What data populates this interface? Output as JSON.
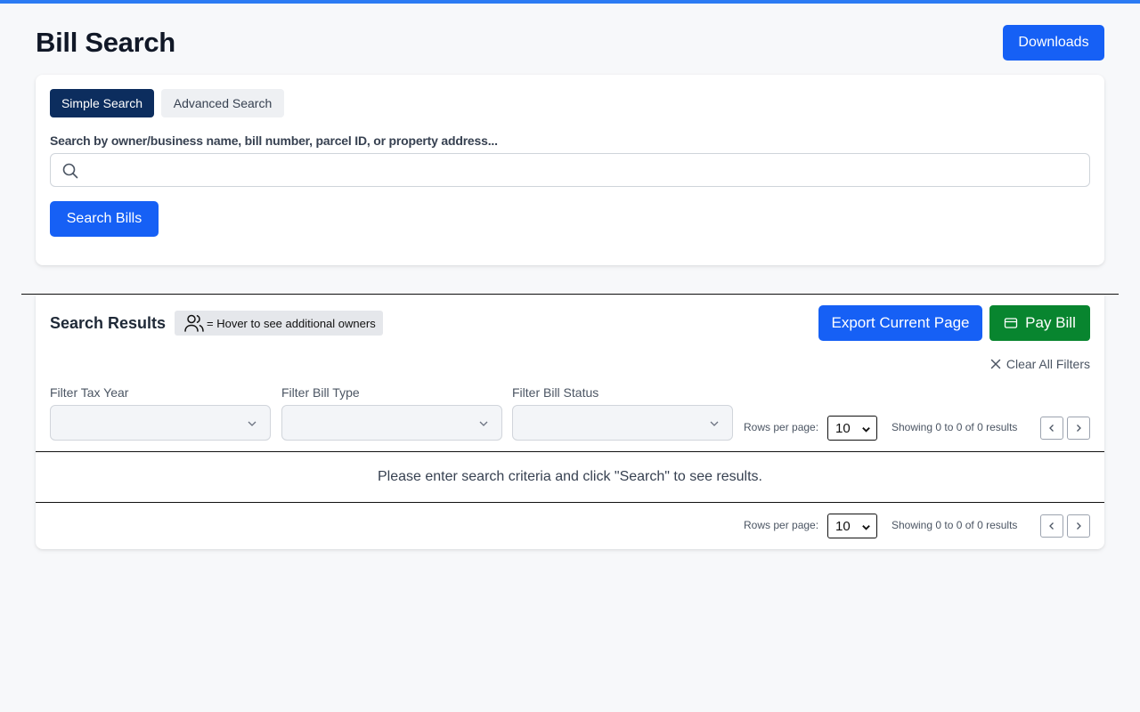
{
  "header": {
    "title": "Bill Search",
    "downloads_label": "Downloads"
  },
  "search": {
    "tabs": [
      {
        "label": "Simple Search",
        "active": true
      },
      {
        "label": "Advanced Search",
        "active": false
      }
    ],
    "label": "Search by owner/business name, bill number, parcel ID, or property address...",
    "value": "",
    "placeholder": "",
    "submit_label": "Search Bills"
  },
  "results": {
    "title": "Search Results",
    "owners_hint": "= Hover to see additional owners",
    "export_label": "Export Current Page",
    "pay_label": "Pay Bill",
    "clear_filters_label": "Clear All Filters",
    "filters": [
      {
        "label": "Filter Tax Year",
        "value": ""
      },
      {
        "label": "Filter Bill Type",
        "value": ""
      },
      {
        "label": "Filter Bill Status",
        "value": ""
      }
    ],
    "pagination": {
      "rows_label": "Rows per page:",
      "rows_value": "10",
      "showing": "Showing 0 to 0 of 0 results"
    },
    "empty_message": "Please enter search criteria and click \"Search\" to see results."
  },
  "colors": {
    "accent": "#1660f5",
    "tab_active": "#0c2d5e",
    "pay_button": "#08852f",
    "top_bar": "#2b7bf3"
  },
  "icons": {
    "search": "search-icon",
    "owners": "users-icon",
    "pay": "credit-card-icon",
    "clear": "close-icon",
    "select": "chevron-down-icon",
    "prev": "chevron-left-icon",
    "next": "chevron-right-icon"
  }
}
